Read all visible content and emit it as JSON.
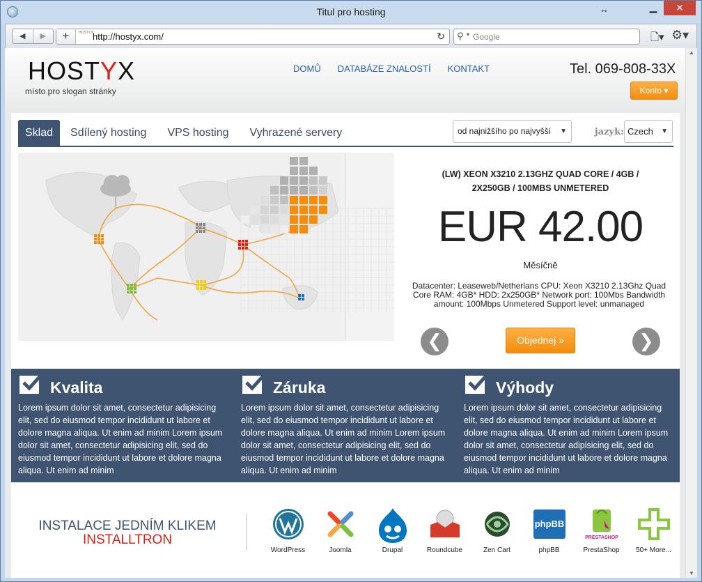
{
  "window": {
    "title": "Titul pro hosting"
  },
  "browser": {
    "url": "http://hostyx.com/",
    "favicon_text": "HOSTYX",
    "search_placeholder": "Google"
  },
  "header": {
    "logo_pre": "HOST",
    "logo_y": "Y",
    "logo_post": "X",
    "slogan": "místo pro slogan stránky",
    "nav": [
      "DOMŮ",
      "DATABÁZE ZNALOSTÍ",
      "KONTAKT"
    ],
    "phone": "Tel. 069-808-33X",
    "account_label": "Konto ▾"
  },
  "tabs": [
    "Sklad",
    "Sdílený hosting",
    "VPS hosting",
    "Vyhrazené servery"
  ],
  "sort_value": "od najnižšího po najvyšší",
  "lang_label": "jazyk:",
  "lang_value": "Czech",
  "product": {
    "title": "(LW) XEON X3210 2.13GHZ QUAD CORE / 4GB / 2X250GB / 100MBS UNMETERED",
    "price": "EUR 42.00",
    "period": "Měsíčně",
    "description": "Datacenter: Leaseweb/Netherlans CPU: Xeon X3210 2.13Ghz Quad Core RAM: 4GB* HDD: 2x250GB* Network port: 100Mbs Bandwidth amount: 100Mbps Unmetered Support level: unmanaged",
    "order_label": "Objednej »",
    "prev_label": "❮",
    "next_label": "❯"
  },
  "features": [
    {
      "title": "Kvalita",
      "text": "Lorem ipsum dolor sit amet, consectetur adipisicing elit, sed do eiusmod tempor incididunt ut labore et dolore magna aliqua. Ut enim ad minim Lorem ipsum dolor sit amet, consectetur adipisicing elit, sed do eiusmod tempor incididunt ut labore et dolore magna aliqua. Ut enim ad minim"
    },
    {
      "title": "Záruka",
      "text": "Lorem ipsum dolor sit amet, consectetur adipisicing elit, sed do eiusmod tempor incididunt ut labore et dolore magna aliqua. Ut enim ad minim Lorem ipsum dolor sit amet, consectetur adipisicing elit, sed do eiusmod tempor incididunt ut labore et dolore magna aliqua. Ut enim ad minim"
    },
    {
      "title": "Výhody",
      "text": "Lorem ipsum dolor sit amet, consectetur adipisicing elit, sed do eiusmod tempor incididunt ut labore et dolore magna aliqua. Ut enim ad minim Lorem ipsum dolor sit amet, consectetur adipisicing elit, sed do eiusmod tempor incididunt ut labore et dolore magna aliqua. Ut enim ad minim"
    }
  ],
  "install": {
    "heading": "INSTALACE JEDNÍM KLIKEM",
    "sub": "INSTALLTRON",
    "apps": [
      "WordPress",
      "Joomla",
      "Drupal",
      "Roundcube",
      "Zen Cart",
      "phpBB",
      "PrestaShop",
      "50+ More..."
    ],
    "phpbb_logo_text": "phpBB",
    "presta_logo_text": "PRESTASHOP"
  },
  "colors": {
    "accent_orange": "#f48c0c",
    "navy": "#3f5470",
    "logo_red": "#e22017",
    "link_blue": "#2a5fa8"
  }
}
